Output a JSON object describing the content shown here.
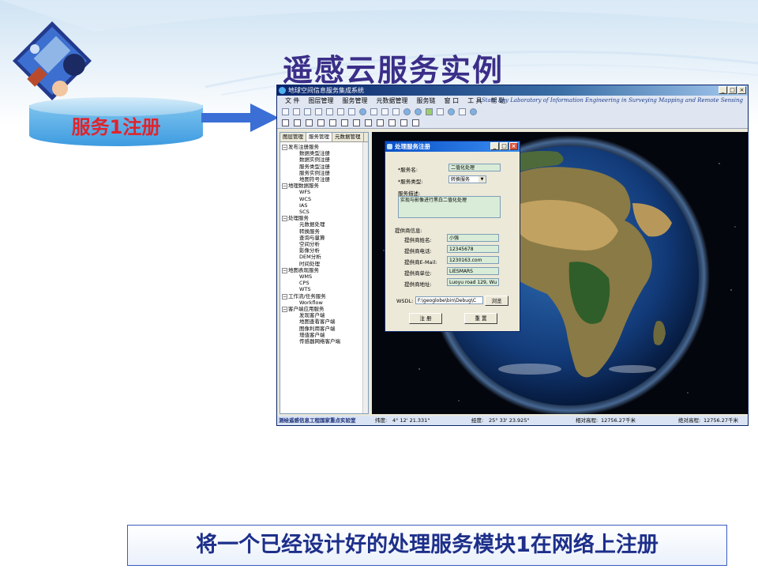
{
  "slide": {
    "title": "遥感云服务实例",
    "step_label": "服务1注册",
    "caption": "将一个已经设计好的处理服务模块1在网络上注册"
  },
  "window": {
    "title": "地球空间信息服务集成系统",
    "menu": [
      "文 件",
      "图层管理",
      "服务管理",
      "元数据管理",
      "服务链",
      "窗 口",
      "工 具",
      "帮 助"
    ],
    "lab_name": "State Key Laboratory of Information Engineering in Surveying Mapping and Remote Sensing",
    "panel_tabs": [
      "图层管理",
      "服务管理",
      "元数据管理"
    ],
    "active_tab": 1,
    "tree": [
      {
        "label": "发布注册服务",
        "children": [
          "数据类型注册",
          "数据实例注册",
          "服务类型注册",
          "服务实例注册",
          "地图符号注册"
        ]
      },
      {
        "label": "地理数据服务",
        "children": [
          "WFS",
          "WCS",
          "IAS",
          "SCS"
        ]
      },
      {
        "label": "处理服务",
        "children": [
          "元数据处理",
          "转换服务",
          "查询与量算",
          "空间分析",
          "影像分析",
          "DEM分析",
          "时间处理"
        ]
      },
      {
        "label": "地图表现服务",
        "children": [
          "WMS",
          "CPS",
          "WTS"
        ]
      },
      {
        "label": "工作流/任务服务",
        "children": [
          "Workflow"
        ]
      },
      {
        "label": "客户端应用服务",
        "children": [
          "发现客户端",
          "地图查看客户端",
          "图像利用客户端",
          "增值客户端",
          "传感器网络客户端"
        ]
      }
    ],
    "status": {
      "lab_short": "测绘遥感信息工程国家重点实验室",
      "lat_label": "纬度:",
      "lat_value": "4° 12' 21.331\"",
      "lon_label": "经度:",
      "lon_value": "25° 33' 23.925\"",
      "rel_label": "相对高程:",
      "rel_value": "12756.27千米",
      "abs_label": "绝对高程:",
      "abs_value": "12756.27千米"
    }
  },
  "dialog": {
    "title": "处理服务注册",
    "service_name_label": "*服务名:",
    "service_name": "二值化处理",
    "service_type_label": "*服务类型:",
    "service_type": "转换服务",
    "description_label": "服务描述:",
    "description": "实现与影像进行黑白二值化处理",
    "provider_info_label": "提供商信息:",
    "provider_fields": [
      {
        "label": "提供商姓名:",
        "value": "小强"
      },
      {
        "label": "提供商电话:",
        "value": "12345678"
      },
      {
        "label": "提供商E-Mail:",
        "value": "1230163.com"
      },
      {
        "label": "提供商单位:",
        "value": "LIESMARS"
      },
      {
        "label": "提供商地址:",
        "value": "Luoyu road 129, Wu"
      }
    ],
    "wsdl_label": "WSDL:",
    "wsdl_value": "F:\\geoglobe\\bin\\Debug\\C",
    "browse_label": "浏览",
    "register_label": "注 册",
    "reset_label": "重 置"
  }
}
